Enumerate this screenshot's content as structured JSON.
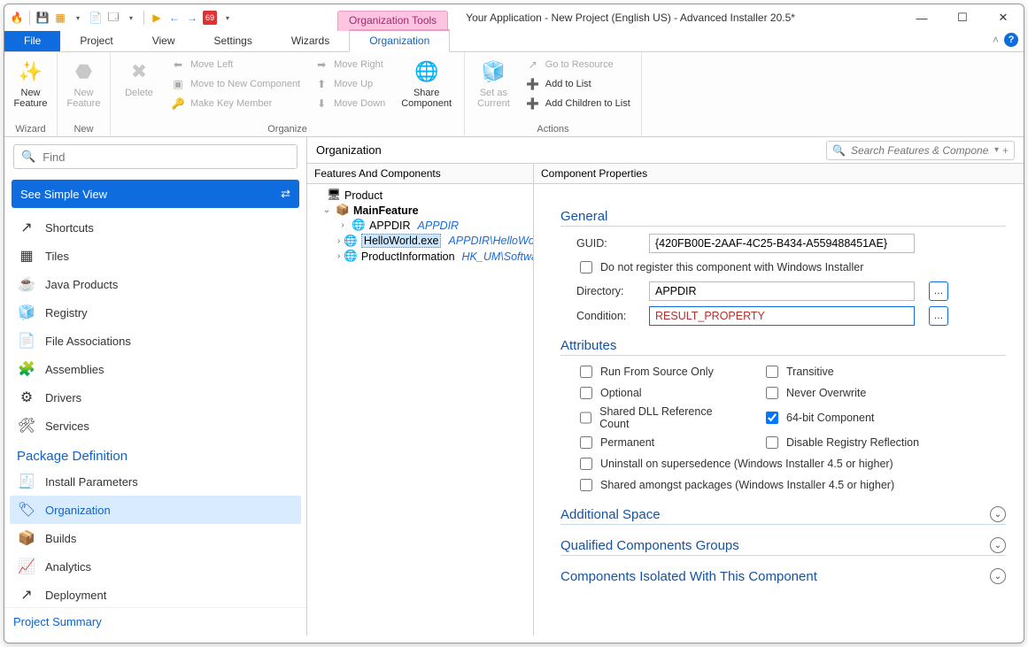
{
  "window": {
    "title": "Your Application - New Project (English US) - Advanced Installer 20.5*",
    "context_tab": "Organization Tools"
  },
  "menu": {
    "file": "File",
    "project": "Project",
    "view": "View",
    "settings": "Settings",
    "wizards": "Wizards",
    "organization": "Organization"
  },
  "ribbon": {
    "new_feature": "New\nFeature",
    "new_feature2": "New\nFeature",
    "delete": "Delete",
    "move_left": "Move Left",
    "move_right": "Move Right",
    "move_to_new_component": "Move to New Component",
    "move_up": "Move Up",
    "make_key_member": "Make Key Member",
    "move_down": "Move Down",
    "share_component": "Share\nComponent",
    "set_as_current": "Set as\nCurrent",
    "go_to_resource": "Go to Resource",
    "add_to_list": "Add to List",
    "add_children": "Add Children to List",
    "group_wizard": "Wizard",
    "group_new": "New",
    "group_organize": "Organize",
    "group_actions": "Actions"
  },
  "left": {
    "find_ph": "Find",
    "simple": "See Simple View",
    "items": {
      "shortcuts": "Shortcuts",
      "tiles": "Tiles",
      "java": "Java Products",
      "registry": "Registry",
      "fileassoc": "File Associations",
      "assemblies": "Assemblies",
      "drivers": "Drivers",
      "services": "Services"
    },
    "pkgdef": "Package Definition",
    "pkg": {
      "install": "Install Parameters",
      "organization": "Organization",
      "builds": "Builds",
      "analytics": "Analytics",
      "deployment": "Deployment"
    },
    "summary": "Project Summary"
  },
  "center": {
    "header": "Organization",
    "search_ph": "Search Features & Components",
    "tree_title": "Features And Components",
    "prop_title": "Component Properties",
    "tree": {
      "product": "Product",
      "mainfeature": "MainFeature",
      "appdir": "APPDIR",
      "appdir_sub": "APPDIR",
      "hello": "HelloWorld.exe",
      "hello_sub": "APPDIR\\HelloWorld.",
      "pinfo": "ProductInformation",
      "pinfo_sub": "HK_UM\\Softwar"
    }
  },
  "props": {
    "general": "General",
    "guid_l": "GUID:",
    "guid_v": "{420FB00E-2AAF-4C25-B434-A559488451AE}",
    "noreg": "Do not register this component with Windows Installer",
    "dir_l": "Directory:",
    "dir_v": "APPDIR",
    "cond_l": "Condition:",
    "cond_v": "RESULT_PROPERTY",
    "attributes": "Attributes",
    "attr": {
      "rfs": "Run From Source Only",
      "trans": "Transitive",
      "opt": "Optional",
      "never": "Never Overwrite",
      "shared": "Shared DLL Reference Count",
      "b64": "64-bit Component",
      "perm": "Permanent",
      "disreg": "Disable Registry Reflection",
      "unin": "Uninstall on supersedence (Windows Installer 4.5 or higher)",
      "shamong": "Shared amongst packages (Windows Installer 4.5 or higher)"
    },
    "addspace": "Additional Space",
    "qcg": "Qualified Components Groups",
    "isol": "Components Isolated With This Component"
  }
}
